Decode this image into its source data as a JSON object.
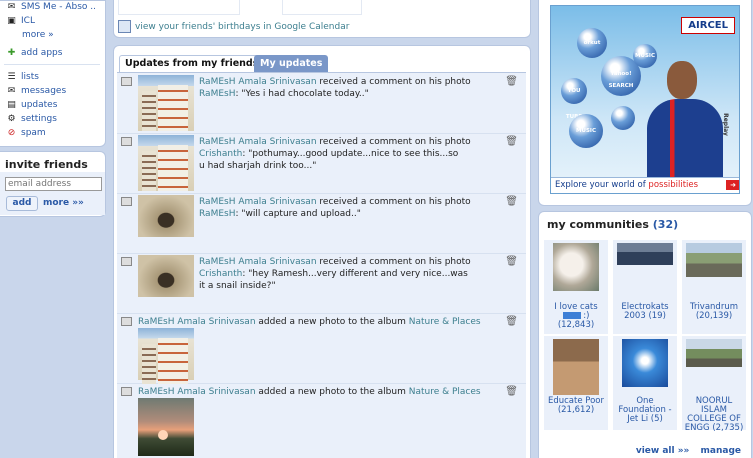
{
  "sidebar": {
    "apps": [
      {
        "label": "SMS Me - Abso ..",
        "icon": "sms-icon"
      },
      {
        "label": "ICL",
        "icon": "app-icon"
      }
    ],
    "more_label": "more »",
    "add_apps_label": "add apps",
    "nav": [
      {
        "label": "lists",
        "icon": "list-icon"
      },
      {
        "label": "messages",
        "icon": "envelope-icon"
      },
      {
        "label": "updates",
        "icon": "updates-icon"
      },
      {
        "label": "settings",
        "icon": "wrench-icon"
      },
      {
        "label": "spam",
        "icon": "spam-icon"
      }
    ],
    "invite": {
      "title": "invite friends",
      "placeholder": "email address",
      "add_label": "add",
      "more_label": "more »»"
    }
  },
  "calendar": {
    "link": "view your friends' birthdays in Google Calendar"
  },
  "tabs": {
    "friends": "Updates from my friends",
    "mine": "My updates"
  },
  "feed": [
    {
      "user": "RaMEsH Amala Srinivasan",
      "action": "received a comment on his photo",
      "commenter": "RaMEsH",
      "comment": ": \"Yes i had chocolate today..\"",
      "comment2": ""
    },
    {
      "user": "RaMEsH Amala Srinivasan",
      "action": "received a comment on his photo",
      "commenter": "Crishanth",
      "comment": ": \"pothumay...good update...nice to see this...so",
      "comment2": "u had sharjah drink too...\""
    },
    {
      "user": "RaMEsH Amala Srinivasan",
      "action": "received a comment on his photo",
      "commenter": "RaMEsH",
      "comment": ": \"will capture and upload..\"",
      "comment2": ""
    },
    {
      "user": "RaMEsH Amala Srinivasan",
      "action": "received a comment on his photo",
      "commenter": "Crishanth",
      "comment": ": \"hey Ramesh...very different and very nice...was",
      "comment2": "it a snail inside?\""
    },
    {
      "user": "RaMEsH Amala Srinivasan",
      "action": "added a new photo to the album",
      "album": "Nature & Places"
    },
    {
      "user": "RaMEsH Amala Srinivasan",
      "action": "added a new photo to the album",
      "album": "Nature & Places"
    }
  ],
  "ad": {
    "brand": "AIRCEL",
    "bubbles": [
      "orkut",
      "Yahoo!",
      "SEARCH",
      "MUSIC",
      "YOU TUBE",
      "MUSIC",
      "Replay"
    ],
    "footer": "Explore your world of",
    "footer_highlight": "possibilities"
  },
  "communities": {
    "title": "my communities",
    "count": "(32)",
    "items": [
      {
        "name": "I love cats",
        "extra": ":)",
        "count": "(12,843)"
      },
      {
        "name": "Electrokats 2003",
        "count": "(19)"
      },
      {
        "name": "Trivandrum",
        "count": "(20,139)"
      },
      {
        "name": "Educate Poor",
        "count": "(21,612)"
      },
      {
        "name": "One Foundation - Jet Li",
        "count": "(5)"
      },
      {
        "name": "NOORUL ISLAM COLLEGE OF ENGG",
        "count": "(2,735)"
      }
    ],
    "view_all": "view all »»",
    "manage": "manage"
  },
  "colors": {
    "link": "#2a59a6",
    "teal": "#3d7f8f",
    "page_bg": "#c9d6eb",
    "feed_bg": "#eaf0fa",
    "tab_active": "#7a97c8"
  }
}
